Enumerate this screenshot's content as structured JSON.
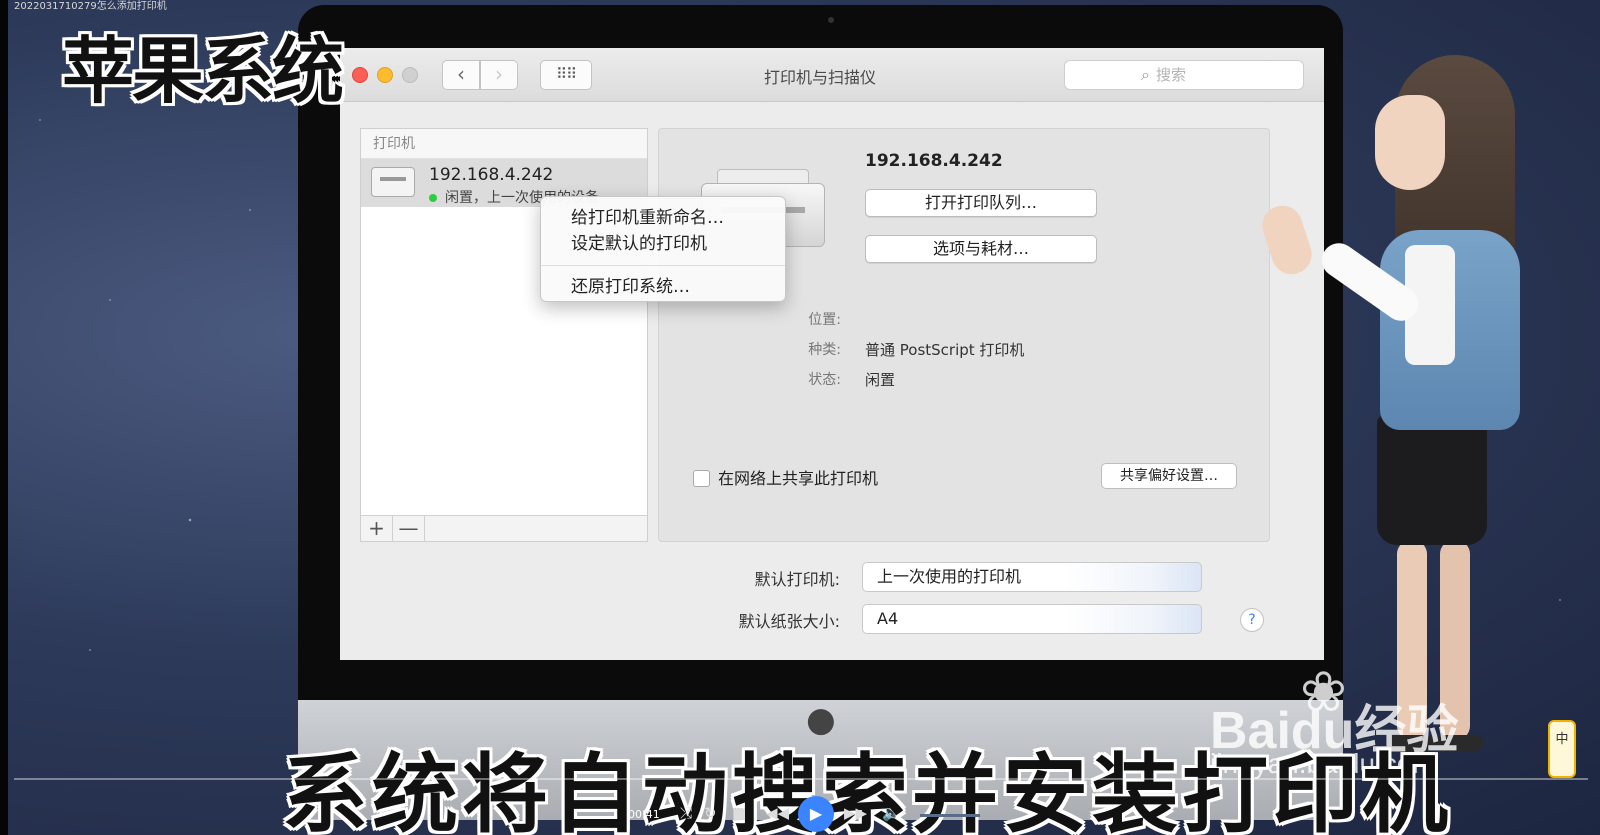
{
  "video": {
    "tiny_title": "2022031710279怎么添加打印机",
    "top_caption": "苹果系统",
    "bottom_caption": "系统将自动搜索并安装打印机",
    "progress": 0.0,
    "time": "00:41"
  },
  "window": {
    "title": "打印机与扫描仪",
    "search_placeholder": "搜索",
    "nav_back": "‹",
    "nav_forward": "›",
    "grid_icon": "⠿⠿"
  },
  "printer_list": {
    "header": "打印机",
    "items": [
      {
        "name": "192.168.4.242",
        "status": "闲置，上一次使用的设备"
      }
    ],
    "add_label": "+",
    "remove_label": "—"
  },
  "context_menu": {
    "items": [
      "给打印机重新命名…",
      "设定默认的打印机",
      "还原打印系统…"
    ]
  },
  "details": {
    "name": "192.168.4.242",
    "open_queue": "打开打印队列…",
    "options": "选项与耗材…",
    "location_label": "位置:",
    "location_value": "",
    "kind_label": "种类:",
    "kind_value": "普通 PostScript 打印机",
    "status_label": "状态:",
    "status_value": "闲置",
    "share_label": "在网络上共享此打印机",
    "share_prefs": "共享偏好设置…"
  },
  "defaults": {
    "printer_label": "默认打印机:",
    "printer_value": "上一次使用的打印机",
    "paper_label": "默认纸张大小:",
    "paper_value": "A4",
    "help": "?"
  },
  "watermark": {
    "brand": "Bai",
    "paw": "❀",
    "suffix": "du经验",
    "url": "jingyan.baidu.com"
  },
  "ime": {
    "label": "中"
  },
  "colors": {
    "accent": "#3a84ff",
    "close": "#fc5f56",
    "minimize": "#fdbc2e"
  }
}
